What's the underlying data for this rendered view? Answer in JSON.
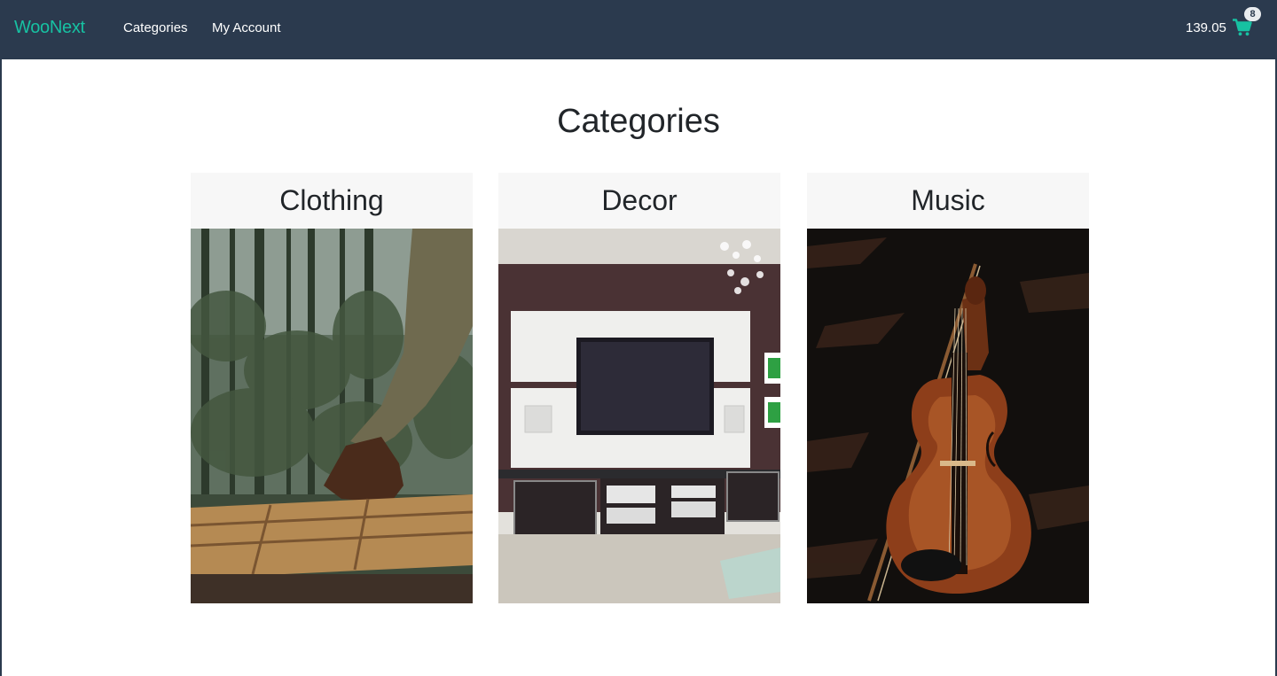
{
  "nav": {
    "brand": "WooNext",
    "links": [
      "Categories",
      "My Account"
    ]
  },
  "cart": {
    "total": "139.05",
    "count": "8",
    "icon": "shopping-cart-icon"
  },
  "page": {
    "title": "Categories"
  },
  "categories": [
    {
      "name": "Clothing"
    },
    {
      "name": "Decor"
    },
    {
      "name": "Music"
    }
  ],
  "colors": {
    "navbar": "#2b3a4e",
    "accent": "#17c1a2",
    "card_header": "#f7f7f7"
  }
}
